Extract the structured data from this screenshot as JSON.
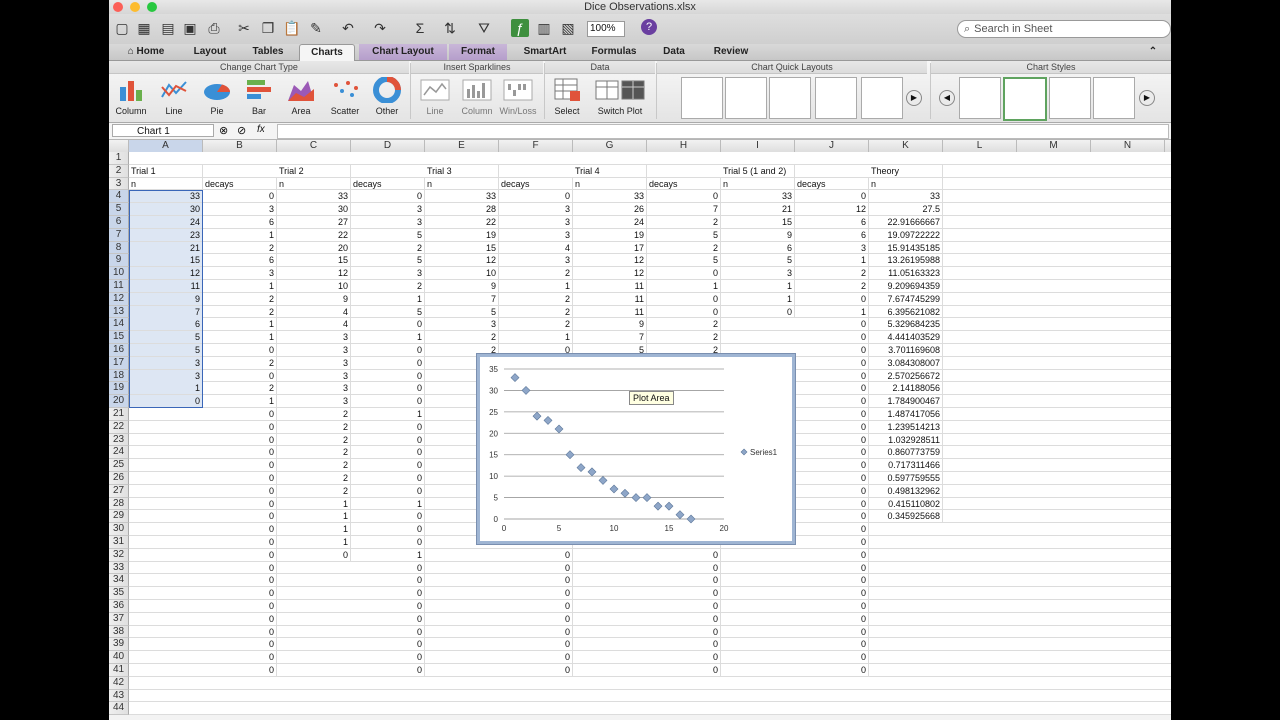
{
  "window": {
    "title": "Dice Observations.xlsx"
  },
  "toolbar": {
    "zoom": "100%",
    "search_placeholder": "Search in Sheet"
  },
  "tabs": [
    "Home",
    "Layout",
    "Tables",
    "Charts",
    "Chart Layout",
    "Format",
    "SmartArt",
    "Formulas",
    "Data",
    "Review"
  ],
  "ribbon": {
    "groups": [
      "Change Chart Type",
      "Insert Sparklines",
      "Data",
      "Chart Quick Layouts",
      "Chart Styles"
    ],
    "chart_types": [
      "Column",
      "Line",
      "Pie",
      "Bar",
      "Area",
      "Scatter",
      "Other"
    ],
    "sparklines": [
      "Line",
      "Column",
      "Win/Loss"
    ],
    "data_buttons": [
      "Select",
      "Switch Plot"
    ]
  },
  "formula_bar": {
    "name_box": "Chart 1",
    "fx": "fx"
  },
  "columns": [
    "A",
    "B",
    "C",
    "D",
    "E",
    "F",
    "G",
    "H",
    "I",
    "J",
    "K",
    "L",
    "M",
    "N"
  ],
  "row_count": 44,
  "sheet": {
    "row2": [
      "Trial 1",
      "",
      "Trial 2",
      "",
      "Trial 3",
      "",
      "Trial 4",
      "",
      "Trial 5 (1 and 2)",
      "",
      "Theory"
    ],
    "row3": [
      "n",
      "decays",
      "n",
      "decays",
      "n",
      "decays",
      "n",
      "decays",
      "n",
      "decays",
      "n"
    ],
    "A": [
      33,
      30,
      24,
      23,
      21,
      15,
      12,
      11,
      9,
      7,
      6,
      5,
      5,
      3,
      3,
      1,
      0
    ],
    "B": [
      0,
      3,
      6,
      1,
      2,
      6,
      3,
      1,
      2,
      2,
      1,
      1,
      0,
      2,
      0,
      2,
      1,
      0,
      0,
      0,
      0,
      0,
      0,
      0,
      0,
      0,
      0,
      0,
      0,
      0,
      0,
      0,
      0,
      0,
      0,
      0,
      0,
      0
    ],
    "C": [
      33,
      30,
      27,
      22,
      20,
      15,
      12,
      10,
      9,
      4,
      4,
      3,
      3,
      3,
      3,
      3,
      3,
      2,
      2,
      2,
      2,
      2,
      2,
      2,
      1,
      1,
      1,
      1,
      0
    ],
    "D": [
      0,
      3,
      3,
      5,
      2,
      5,
      3,
      2,
      1,
      5,
      0,
      1,
      0,
      0,
      0,
      0,
      0,
      1,
      0,
      0,
      0,
      0,
      0,
      0,
      1,
      0,
      0,
      0,
      1,
      0,
      0,
      0,
      0,
      0,
      0,
      0,
      0,
      0
    ],
    "E": [
      33,
      28,
      22,
      19,
      15,
      12,
      10,
      9,
      7,
      5,
      3,
      2,
      2
    ],
    "F": [
      0,
      3,
      3,
      3,
      4,
      3,
      2,
      1,
      2,
      2,
      2,
      1,
      0,
      0,
      0,
      0,
      0,
      0,
      0,
      0,
      0,
      0,
      0,
      0,
      0,
      0,
      0,
      0,
      0,
      0,
      0,
      0,
      0,
      0,
      0,
      0,
      0,
      0
    ],
    "G": [
      33,
      26,
      24,
      19,
      17,
      12,
      12,
      11,
      11,
      11,
      9,
      7,
      5
    ],
    "H": [
      0,
      7,
      2,
      5,
      2,
      5,
      0,
      1,
      0,
      0,
      2,
      2,
      2,
      0,
      0,
      0,
      0,
      0,
      0,
      0,
      0,
      0,
      0,
      0,
      0,
      0,
      0,
      0,
      0,
      0,
      0,
      0,
      0,
      0,
      0,
      0,
      0,
      0
    ],
    "I": [
      33,
      21,
      15,
      9,
      6,
      5,
      3,
      1,
      1,
      0
    ],
    "J": [
      0,
      12,
      6,
      6,
      3,
      1,
      2,
      2,
      0,
      1,
      0,
      0,
      0,
      0,
      0,
      0,
      0,
      0,
      0,
      0,
      0,
      0,
      0,
      0,
      0,
      0,
      0,
      0,
      0,
      0,
      0,
      0,
      0,
      0,
      0,
      0,
      0,
      0
    ],
    "K": [
      "33",
      "27.5",
      "22.91666667",
      "19.09722222",
      "15.91435185",
      "13.26195988",
      "11.05163323",
      "9.209694359",
      "7.674745299",
      "6.395621082",
      "5.329684235",
      "4.441403529",
      "3.701169608",
      "3.084308007",
      "2.570256672",
      "2.14188056",
      "1.784900467",
      "1.487417056",
      "1.239514213",
      "1.032928511",
      "0.860773759",
      "0.717311466",
      "0.597759555",
      "0.498132962",
      "0.415110802",
      "0.345925668"
    ]
  },
  "chart_data": {
    "type": "scatter",
    "series": [
      {
        "name": "Series1",
        "x": [
          1,
          2,
          3,
          4,
          5,
          6,
          7,
          8,
          9,
          10,
          11,
          12,
          13,
          14,
          15,
          16,
          17
        ],
        "y": [
          33,
          30,
          24,
          23,
          21,
          15,
          12,
          11,
          9,
          7,
          6,
          5,
          5,
          3,
          3,
          1,
          0
        ]
      }
    ],
    "xlim": [
      0,
      20
    ],
    "ylim": [
      0,
      35
    ],
    "xticks": [
      0,
      5,
      10,
      15,
      20
    ],
    "yticks": [
      0,
      5,
      10,
      15,
      20,
      25,
      30,
      35
    ],
    "grid": "horizontal",
    "legend": "right",
    "marker_color": "#8ea6c8"
  },
  "tooltip": "Plot Area"
}
